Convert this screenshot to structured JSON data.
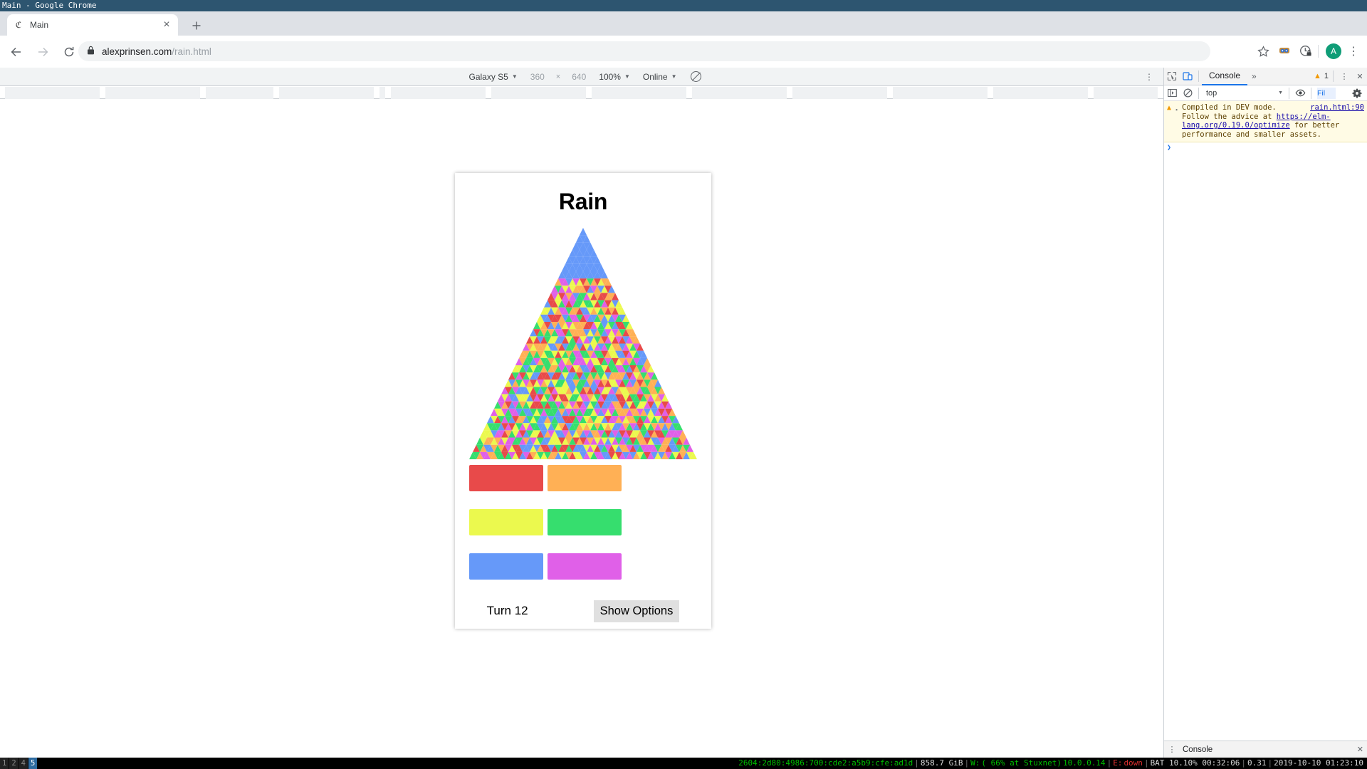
{
  "wm": {
    "title": "Main - Google Chrome"
  },
  "browser": {
    "tab": {
      "title": "Main",
      "favicon": "elm-favicon-icon",
      "close": "×"
    },
    "new_tab": "+",
    "nav": {
      "back": "←",
      "forward": "→",
      "reload": "⟳"
    },
    "omnibox": {
      "lock_icon": "lock-icon",
      "url_domain": "alexprinsen.com",
      "url_path": "/rain.html"
    },
    "right_icons": {
      "bookmark": "star-icon",
      "extension": "extension-goggles-icon",
      "profile_lock": "lock-clock-icon",
      "avatar_letter": "A",
      "menu": "⋮"
    }
  },
  "device_toolbar": {
    "device": "Galaxy S5",
    "width": "360",
    "times": "×",
    "height": "640",
    "zoom": "100%",
    "network": "Online",
    "throttle_icon": "no-throttling-icon",
    "kebab": "⋮",
    "caret": "▼"
  },
  "app": {
    "title": "Rain",
    "turn_label": "Turn 12",
    "show_options_label": "Show Options",
    "swatches": [
      {
        "name": "red",
        "color": "#e84a4a"
      },
      {
        "name": "orange",
        "color": "#ffb055"
      },
      {
        "name": "yellow",
        "color": "#ebf94e"
      },
      {
        "name": "green",
        "color": "#36de6e"
      },
      {
        "name": "blue",
        "color": "#6699f9"
      },
      {
        "name": "magenta",
        "color": "#e060e8"
      }
    ],
    "triangle": {
      "rows": 32,
      "blue_rows": 7,
      "palette": [
        "#e84a4a",
        "#ffb055",
        "#ebf94e",
        "#36de6e",
        "#6699f9",
        "#e060e8"
      ],
      "blue": "#6699f9",
      "seed": 20191010
    }
  },
  "devtools": {
    "inspect_icon": "inspect-cursor-icon",
    "device_icon": "device-toolbar-icon",
    "active_tab": "Console",
    "more_tabs": "»",
    "warning_count": "1",
    "warning_icon": "warning-triangle-icon",
    "kebab": "⋮",
    "close": "✕",
    "sidebar_icon": "show-console-sidebar-icon",
    "clear_icon": "clear-console-icon",
    "context": "top",
    "eye_icon": "live-expression-eye-icon",
    "filter_placeholder": "Fil",
    "settings_icon": "gear-icon",
    "message": {
      "expander": "▸",
      "line1": "Compiled in DEV mode.",
      "line2_pre": "Follow the advice at ",
      "link": "https://elm-lang.org/0.19.0/optimize",
      "line2_post": " for better performance and smaller assets.",
      "source": "rain.html:90"
    },
    "prompt": "❯",
    "drawer_label": "Console",
    "drawer_close": "✕"
  },
  "statusbar": {
    "workspaces": [
      {
        "label": "1",
        "active": false
      },
      {
        "label": "2",
        "active": false
      },
      {
        "label": "4",
        "active": false
      },
      {
        "label": "5",
        "active": true
      }
    ],
    "ipv6": "2604:2d80:4986:700:cde2:a5b9:cfe:ad1d",
    "disk": "858.7 GiB",
    "wifi_label": "W:",
    "wifi_detail": "( 66% at Stuxnet)",
    "lan_ip": "10.0.0.14",
    "eth_label": "E:",
    "eth_state": "down",
    "battery": "BAT 10.10% 00:32:06",
    "load": "0.31",
    "datetime": "2019-10-10 01:23:10"
  }
}
